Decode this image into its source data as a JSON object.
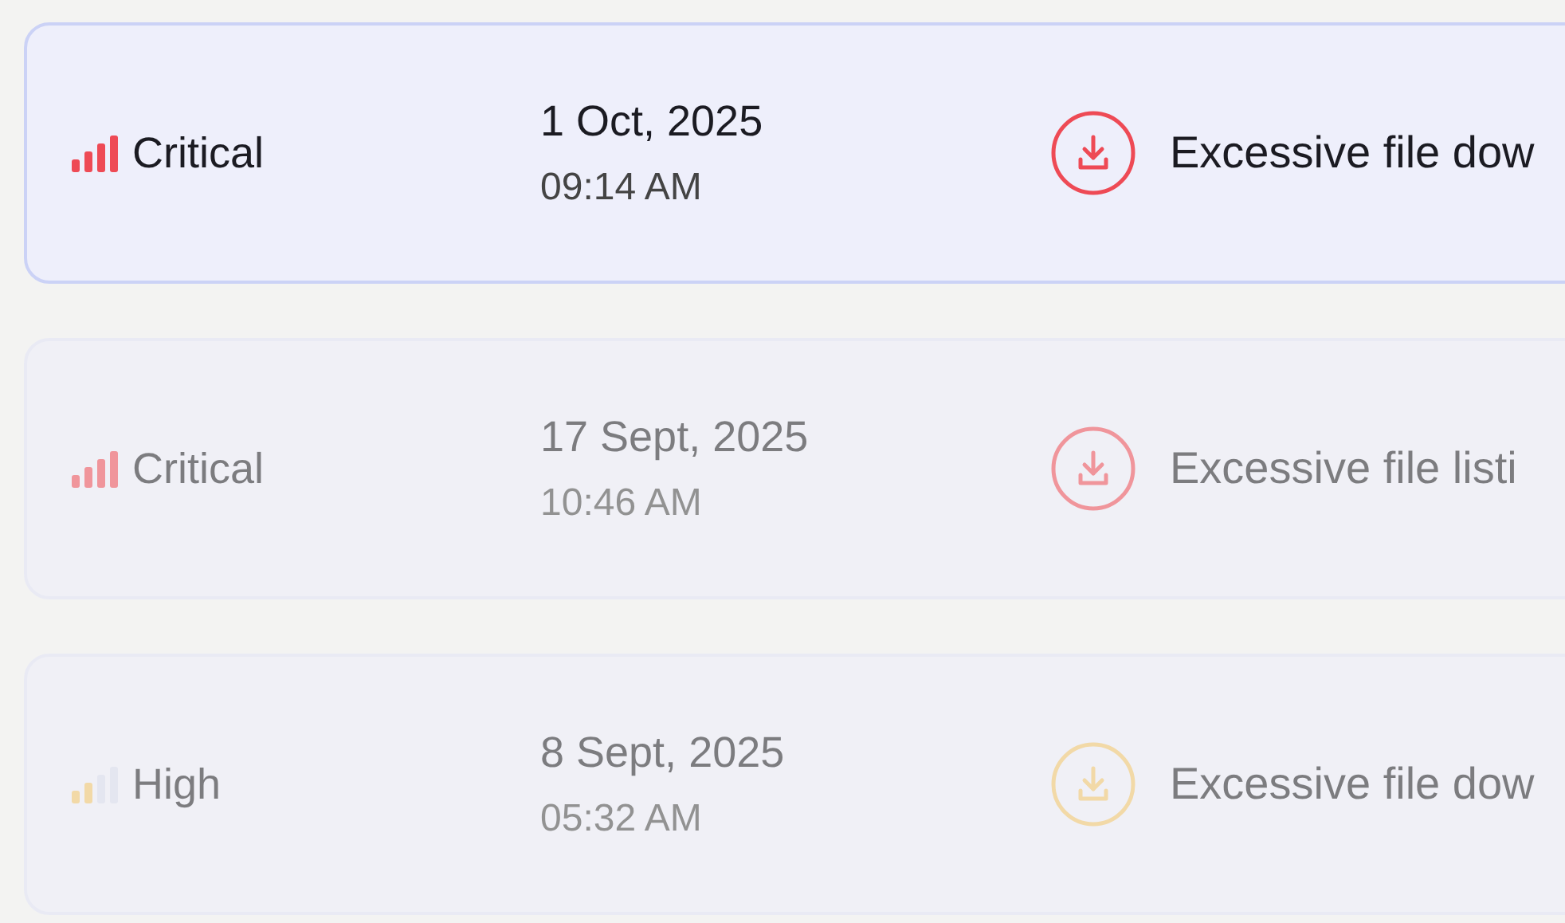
{
  "alerts": [
    {
      "severity": "Critical",
      "kind": "critical",
      "date": "1 Oct, 2025",
      "time": "09:14 AM",
      "description": "Excessive file dow",
      "dimmed": false
    },
    {
      "severity": "Critical",
      "kind": "critical",
      "date": "17 Sept, 2025",
      "time": "10:46 AM",
      "description": "Excessive file listi",
      "dimmed": true
    },
    {
      "severity": "High",
      "kind": "high",
      "date": "8 Sept, 2025",
      "time": "05:32 AM",
      "description": "Excessive file dow",
      "dimmed": true
    }
  ]
}
